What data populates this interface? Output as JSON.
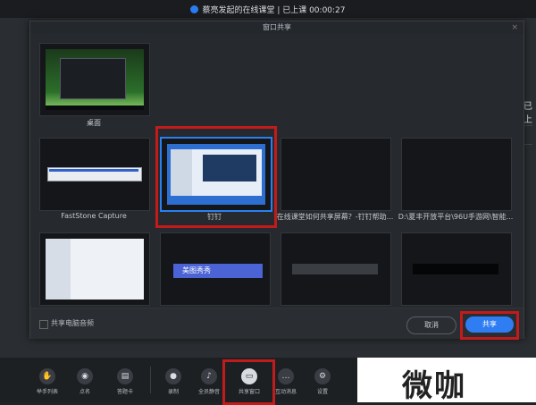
{
  "status_bar": {
    "text": "蔡亮发起的在线课堂 | 已上课 00:00:27"
  },
  "dialog": {
    "title": "窗口共享",
    "windows": [
      {
        "label": "桌面",
        "selected": false
      },
      {
        "label": "FastStone Capture",
        "selected": false
      },
      {
        "label": "钉钉",
        "selected": true
      },
      {
        "label": "在线课堂如何共享屏幕？-钉钉帮助...",
        "selected": false
      },
      {
        "label": "D:\\夏丰开放平台\\96U手游网\\智能...",
        "selected": false
      },
      {
        "label": "",
        "selected": false
      },
      {
        "label": "",
        "selected": false
      },
      {
        "label": "",
        "selected": false
      },
      {
        "label": "",
        "selected": false
      }
    ],
    "audio_checkbox_label": "共享电脑音频",
    "cancel_label": "取消",
    "share_label": "共享"
  },
  "right_side_text": "已上",
  "toolbar": {
    "items": [
      {
        "label": "举手列表",
        "icon": "hand-icon"
      },
      {
        "label": "点名",
        "icon": "location-pin-icon"
      },
      {
        "label": "答题卡",
        "icon": "answer-card-icon"
      },
      {
        "label": "录制",
        "icon": "record-icon"
      },
      {
        "label": "全员静音",
        "icon": "mute-all-icon"
      },
      {
        "label": "共享窗口",
        "icon": "share-window-icon",
        "active": true
      },
      {
        "label": "互动消息",
        "icon": "chat-icon"
      },
      {
        "label": "设置",
        "icon": "gear-icon"
      }
    ]
  },
  "watermark": {
    "text": "微咖"
  },
  "colors": {
    "accent": "#2f7df2",
    "highlight_frame": "#c21b1b"
  }
}
